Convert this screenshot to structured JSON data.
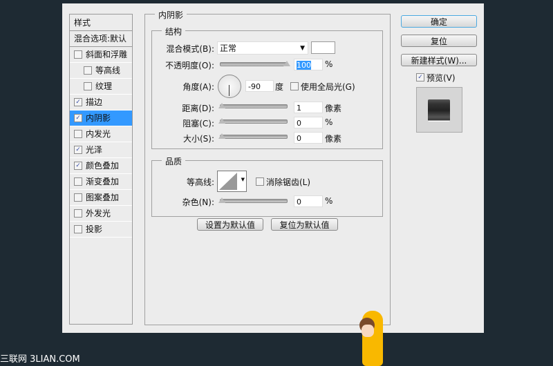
{
  "sidebar": {
    "header": "样式",
    "blend": "混合选项:默认",
    "items": [
      {
        "label": "斜面和浮雕",
        "checked": false,
        "indent": false
      },
      {
        "label": "等高线",
        "checked": false,
        "indent": true
      },
      {
        "label": "纹理",
        "checked": false,
        "indent": true
      },
      {
        "label": "描边",
        "checked": true,
        "indent": false
      },
      {
        "label": "内阴影",
        "checked": true,
        "indent": false,
        "selected": true
      },
      {
        "label": "内发光",
        "checked": false,
        "indent": false
      },
      {
        "label": "光泽",
        "checked": true,
        "indent": false
      },
      {
        "label": "颜色叠加",
        "checked": true,
        "indent": false
      },
      {
        "label": "渐变叠加",
        "checked": false,
        "indent": false
      },
      {
        "label": "图案叠加",
        "checked": false,
        "indent": false
      },
      {
        "label": "外发光",
        "checked": false,
        "indent": false
      },
      {
        "label": "投影",
        "checked": false,
        "indent": false
      }
    ]
  },
  "panel": {
    "title": "内阴影",
    "structure": {
      "title": "结构",
      "blend_label": "混合模式(B):",
      "blend_value": "正常",
      "opacity_label": "不透明度(O):",
      "opacity_value": "100",
      "opacity_unit": "%",
      "opacity_fraction": 1.0,
      "angle_label": "角度(A):",
      "angle_value": "-90",
      "angle_unit": "度",
      "global_light_label": "使用全局光(G)",
      "global_light_checked": false,
      "distance_label": "距离(D):",
      "distance_value": "1",
      "distance_unit": "像素",
      "choke_label": "阻塞(C):",
      "choke_value": "0",
      "choke_unit": "%",
      "size_label": "大小(S):",
      "size_value": "0",
      "size_unit": "像素"
    },
    "quality": {
      "title": "品质",
      "contour_label": "等高线:",
      "antialias_label": "消除锯齿(L)",
      "antialias_checked": false,
      "noise_label": "杂色(N):",
      "noise_value": "0",
      "noise_unit": "%"
    },
    "set_default": "设置为默认值",
    "reset_default": "复位为默认值"
  },
  "buttons": {
    "ok": "确定",
    "reset": "复位",
    "new_style": "新建样式(W)...",
    "preview": "预览(V)",
    "preview_checked": true
  },
  "watermark": "三联网 3LIAN.COM"
}
